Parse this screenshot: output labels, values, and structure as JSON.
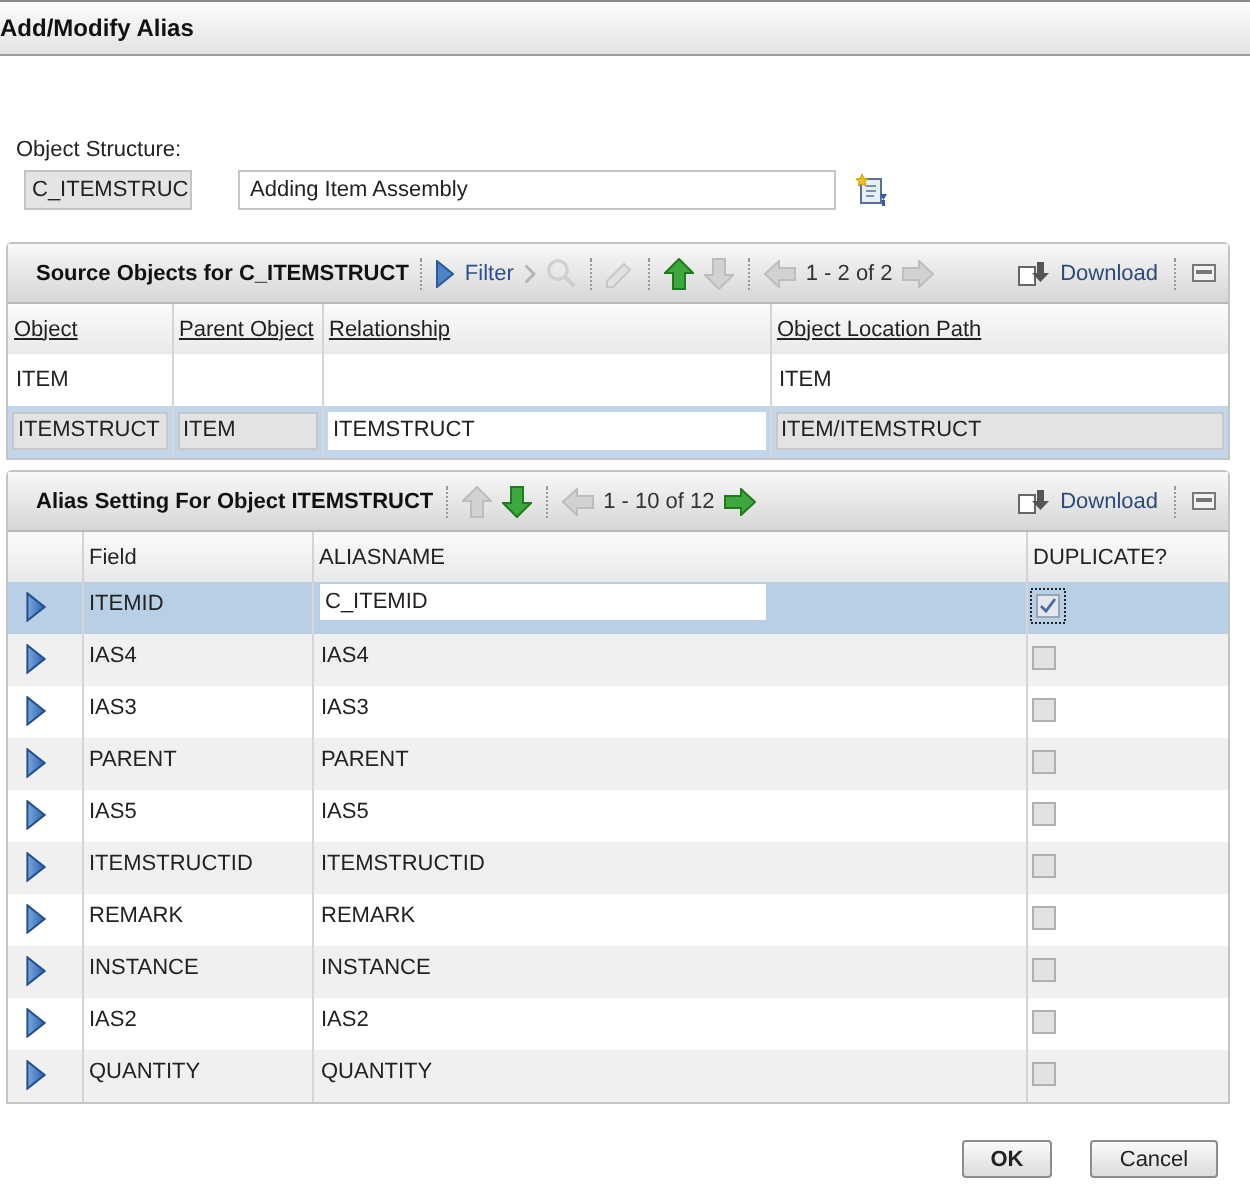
{
  "window": {
    "title": "Add/Modify Alias"
  },
  "object_structure": {
    "label": "Object Structure:",
    "value": "C_ITEMSTRUC",
    "description": "Adding Item Assembly"
  },
  "source_objects": {
    "title": "Source Objects for C_ITEMSTRUCT",
    "toolbar": [
      {
        "kind": "separator"
      },
      {
        "kind": "filter",
        "label": "Filter",
        "disabled": false
      },
      {
        "kind": "chevron",
        "disabled": true
      },
      {
        "kind": "search",
        "disabled": true
      },
      {
        "kind": "separator"
      },
      {
        "kind": "clear",
        "disabled": true
      },
      {
        "kind": "separator"
      },
      {
        "kind": "up",
        "disabled": false
      },
      {
        "kind": "down",
        "disabled": true
      },
      {
        "kind": "separator"
      },
      {
        "kind": "prev",
        "disabled": true
      },
      {
        "kind": "pages",
        "label": "1 - 2 of 2"
      },
      {
        "kind": "next",
        "disabled": true
      }
    ],
    "download": "Download",
    "columns": [
      {
        "label": "Object",
        "editable": false
      },
      {
        "label": "Parent Object",
        "editable": false
      },
      {
        "label": "Relationship",
        "editable": true
      },
      {
        "label": "Object Location Path",
        "editable": false
      }
    ],
    "rows": [
      {
        "object": "ITEM",
        "object_location_path": "ITEM",
        "selected": false
      },
      {
        "object": "ITEMSTRUCT",
        "parent_object": "ITEM",
        "relationship": "ITEMSTRUCT",
        "object_location_path": "ITEM/ITEMSTRUCT",
        "selected": true
      }
    ]
  },
  "alias_setting": {
    "title": "Alias Setting For Object ITEMSTRUCT",
    "toolbar": [
      {
        "kind": "separator"
      },
      {
        "kind": "up",
        "disabled": true
      },
      {
        "kind": "down",
        "disabled": false
      },
      {
        "kind": "separator"
      },
      {
        "kind": "prev",
        "disabled": true
      },
      {
        "kind": "pages",
        "label": "1 - 10 of 12"
      },
      {
        "kind": "next",
        "disabled": false
      }
    ],
    "download": "Download",
    "columns": [
      {
        "label": "Field"
      },
      {
        "label": "ALIASNAME"
      },
      {
        "label": "DUPLICATE?"
      }
    ],
    "rows": [
      {
        "field": "ITEMID",
        "aliasname": "C_ITEMID",
        "duplicate": true,
        "selected": true
      },
      {
        "field": "IAS4",
        "aliasname": "IAS4",
        "duplicate": false,
        "selected": false
      },
      {
        "field": "IAS3",
        "aliasname": "IAS3",
        "duplicate": false,
        "selected": false
      },
      {
        "field": "PARENT",
        "aliasname": "PARENT",
        "duplicate": false,
        "selected": false
      },
      {
        "field": "IAS5",
        "aliasname": "IAS5",
        "duplicate": false,
        "selected": false
      },
      {
        "field": "ITEMSTRUCTID",
        "aliasname": "ITEMSTRUCTID",
        "duplicate": false,
        "selected": false
      },
      {
        "field": "REMARK",
        "aliasname": "REMARK",
        "duplicate": false,
        "selected": false
      },
      {
        "field": "INSTANCE",
        "aliasname": "INSTANCE",
        "duplicate": false,
        "selected": false
      },
      {
        "field": "IAS2",
        "aliasname": "IAS2",
        "duplicate": false,
        "selected": false
      },
      {
        "field": "QUANTITY",
        "aliasname": "QUANTITY",
        "duplicate": false,
        "selected": false
      }
    ]
  },
  "buttons": [
    {
      "label": "OK",
      "primary": true
    },
    {
      "label": "Cancel",
      "primary": false
    }
  ]
}
